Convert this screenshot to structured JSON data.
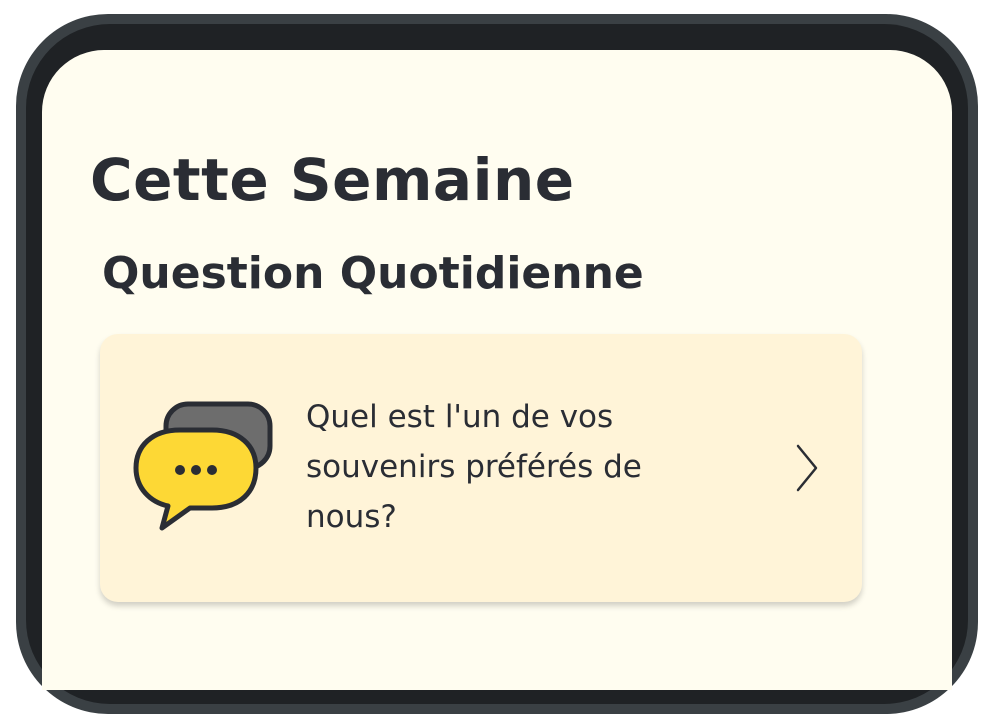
{
  "header": {
    "title": "Cette Semaine"
  },
  "daily_question": {
    "section_title": "Question Quotidienne",
    "question": "Quel est l'un de vos souvenirs préférés de nous?",
    "icon": "chat-bubbles-icon",
    "chevron_icon": "chevron-right-icon"
  },
  "colors": {
    "screen_background": "#fffdf0",
    "card_background": "#fff4d8",
    "text": "#2a2d34",
    "bubble_yellow": "#fdd835",
    "bubble_gray": "#6d6d6d",
    "frame": "#3a4044"
  }
}
